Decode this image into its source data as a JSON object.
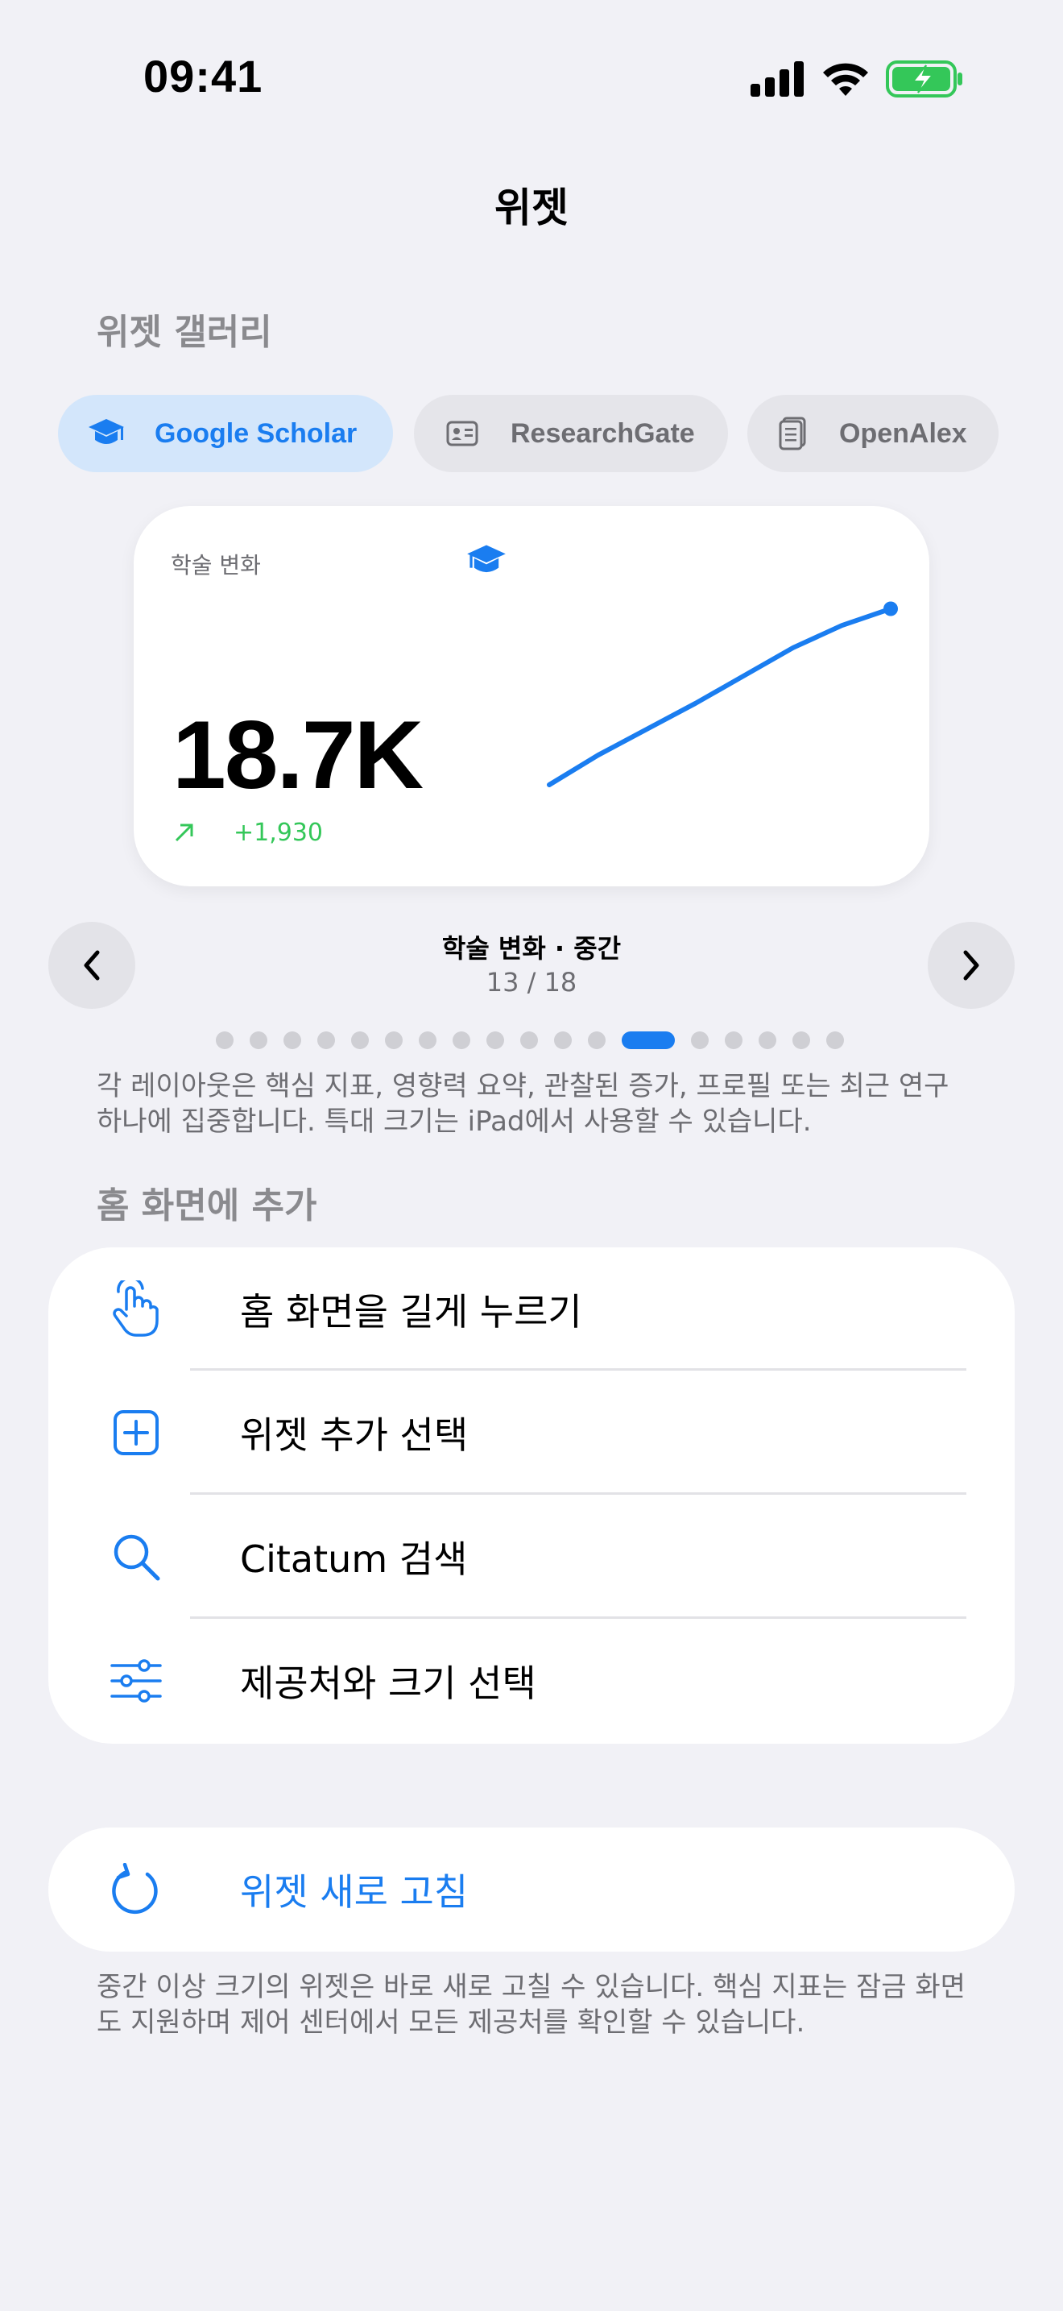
{
  "status_bar": {
    "time": "09:41"
  },
  "nav": {
    "title": "위젯"
  },
  "gallery": {
    "header": "위젯 갤러리",
    "providers": [
      {
        "label": "Google Scholar",
        "icon": "graduation-cap-icon",
        "active": true
      },
      {
        "label": "ResearchGate",
        "icon": "id-card-icon",
        "active": false
      },
      {
        "label": "OpenAlex",
        "icon": "document-icon",
        "active": false
      }
    ]
  },
  "widget_preview": {
    "label": "학술 변화",
    "value": "18.7K",
    "delta": "+1,930",
    "icon": "graduation-cap-icon",
    "accent": "#1a7df0",
    "delta_color": "#34c759",
    "chart_data": {
      "type": "line",
      "x": [
        1,
        2,
        3,
        4,
        5,
        6,
        7,
        8
      ],
      "series": [
        {
          "values": [
            0.0,
            0.16,
            0.3,
            0.44,
            0.59,
            0.74,
            0.86,
            0.95
          ]
        }
      ]
    }
  },
  "pager": {
    "title": "학술 변화 · 중간",
    "count": "13 / 18",
    "total": 18,
    "current": 13
  },
  "gallery_footnote": "각 레이아웃은 핵심 지표, 영향력 요약, 관찰된 증가, 프로필 또는 최근 연구 하나에 집중합니다. 특대 크기는 iPad에서 사용할 수 있습니다.",
  "add_to_home": {
    "header": "홈 화면에 추가",
    "steps": [
      {
        "label": "홈 화면을 길게 누르기",
        "icon": "hand-tap-icon"
      },
      {
        "label": "위젯 추가 선택",
        "icon": "plus-square-icon"
      },
      {
        "label": "Citatum 검색",
        "icon": "search-icon"
      },
      {
        "label": "제공처와 크기 선택",
        "icon": "sliders-icon"
      }
    ]
  },
  "refresh": {
    "label": "위젯 새로 고침",
    "icon": "refresh-icon"
  },
  "refresh_footnote": "중간 이상 크기의 위젯은 바로 새로 고칠 수 있습니다. 핵심 지표는 잠금 화면도 지원하며 제어 센터에서 모든 제공처를 확인할 수 있습니다."
}
